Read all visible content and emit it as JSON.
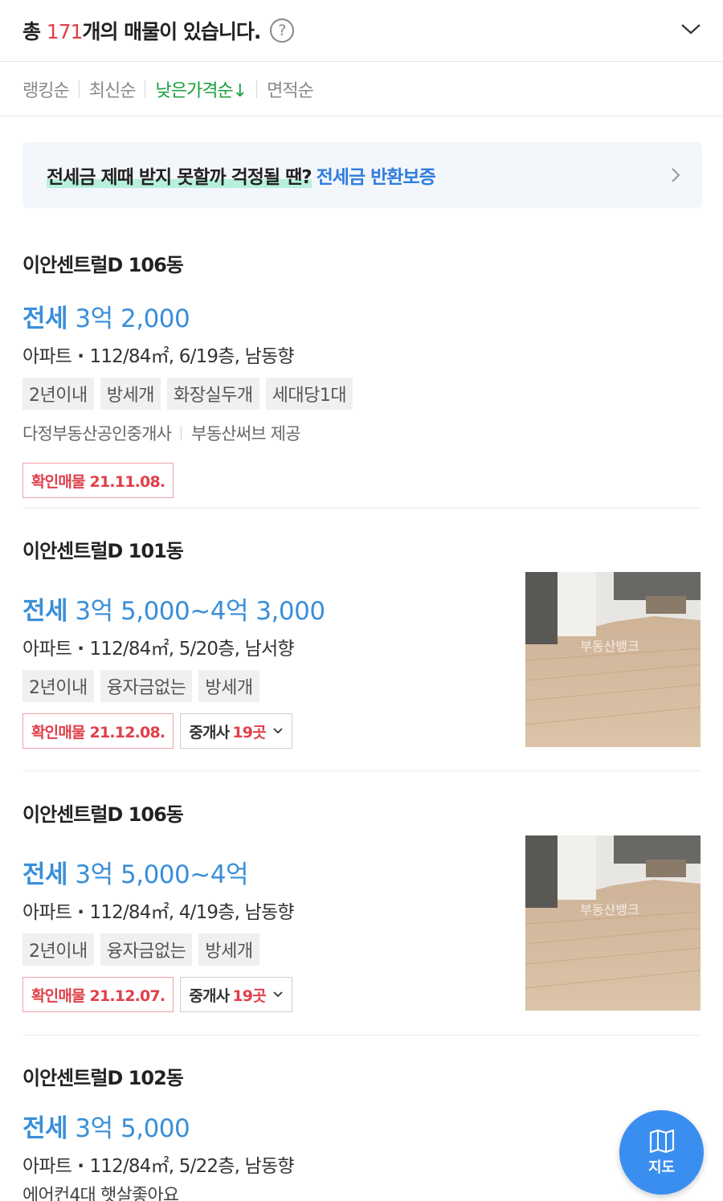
{
  "header": {
    "count_prefix": "총 ",
    "count_num": "171",
    "count_suffix": "개의 매물이 있습니다.",
    "help_icon": "question-circle-icon",
    "collapse_icon": "chevron-down-icon"
  },
  "sort": {
    "items": [
      "랭킹순",
      "최신순",
      "낮은가격순↓",
      "면적순"
    ],
    "active_index": 2
  },
  "banner": {
    "text": "전세금 제때 받지 못할까 걱정될 땐?",
    "link": "전세금 반환보증",
    "chevron_icon": "chevron-right-icon"
  },
  "listings": [
    {
      "title": "이안센트럴D 106동",
      "deal_type": "전세",
      "price": "3억 2,000",
      "spec_type": "아파트",
      "spec_detail": "112/84㎡, 6/19층, 남동향",
      "tags": [
        "2년이내",
        "방세개",
        "화장실두개",
        "세대당1대"
      ],
      "agent": "다정부동산공인중개사",
      "provider": "부동산써브 제공",
      "verified": "확인매물 21.11.08."
    },
    {
      "title": "이안센트럴D 101동",
      "deal_type": "전세",
      "price": "3억 5,000~4억 3,000",
      "spec_type": "아파트",
      "spec_detail": "112/84㎡, 5/20층, 남서향",
      "tags": [
        "2년이내",
        "융자금없는",
        "방세개"
      ],
      "verified": "확인매물 21.12.08.",
      "broker_label": "중개사 ",
      "broker_count": "19곳",
      "thumb_watermark": "부동산뱅크"
    },
    {
      "title": "이안센트럴D 106동",
      "deal_type": "전세",
      "price": "3억 5,000~4억",
      "spec_type": "아파트",
      "spec_detail": "112/84㎡, 4/19층, 남동향",
      "tags": [
        "2년이내",
        "융자금없는",
        "방세개"
      ],
      "verified": "확인매물 21.12.07.",
      "broker_label": "중개사 ",
      "broker_count": "19곳",
      "thumb_watermark": "부동산뱅크"
    },
    {
      "title": "이안센트럴D 102동",
      "deal_type": "전세",
      "price": "3억 5,000",
      "spec_type": "아파트",
      "spec_detail": "112/84㎡, 5/22층, 남동향",
      "description": "에어컨4대 햇살좋아요"
    }
  ],
  "map_button": {
    "label": "지도",
    "icon": "map-icon"
  },
  "colors": {
    "price_blue": "#3a8fd9",
    "active_sort_green": "#1aa03c",
    "verify_red": "#e0404a",
    "map_button_blue": "#3a8ef0"
  }
}
